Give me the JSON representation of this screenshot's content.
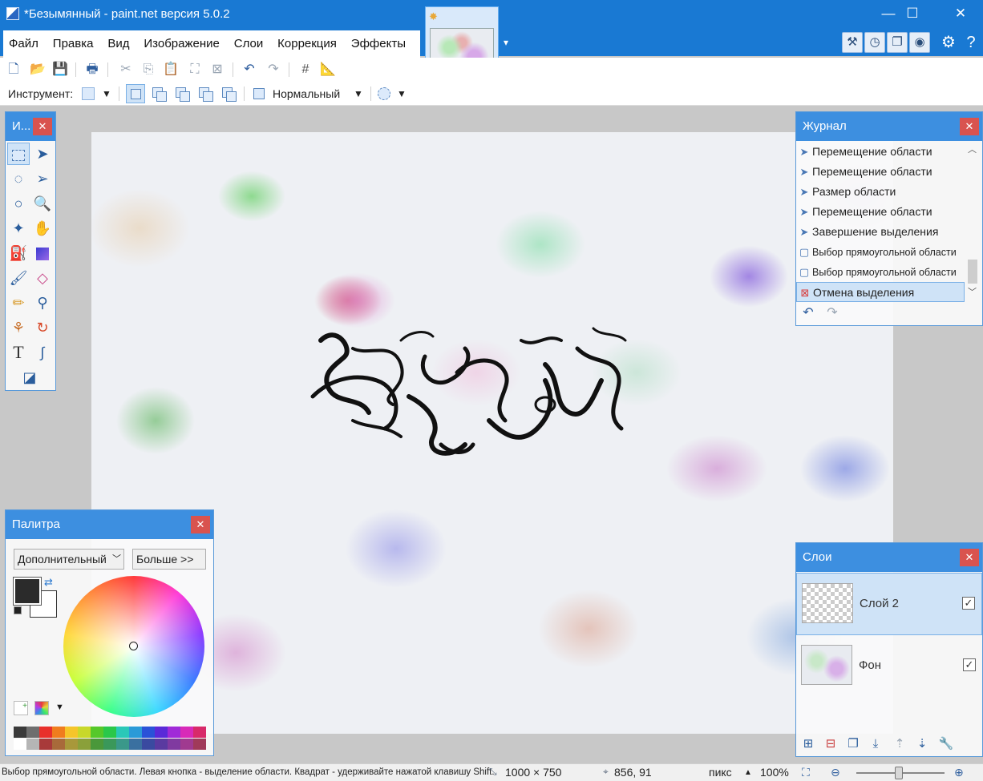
{
  "window": {
    "title": "*Безымянный - paint.net версия 5.0.2",
    "minimize": "—",
    "maximize": "☐",
    "close": "✕"
  },
  "menu": [
    "Файл",
    "Правка",
    "Вид",
    "Изображение",
    "Слои",
    "Коррекция",
    "Эффекты"
  ],
  "toolbar": {
    "tool_label": "Инструмент:",
    "blend_mode": "Нормальный"
  },
  "tools_panel": {
    "title": "И...",
    "close": "✕"
  },
  "history": {
    "title": "Журнал",
    "close": "✕",
    "items": [
      "Перемещение области",
      "Перемещение области",
      "Размер области",
      "Перемещение области",
      "Завершение выделения",
      "Выбор прямоугольной области",
      "Выбор прямоугольной области",
      "Отмена выделения"
    ],
    "selected_index": 7
  },
  "palette": {
    "title": "Палитра",
    "close": "✕",
    "mode": "Дополнительный",
    "more_button": "Больше >>",
    "primary_color": "#2b2b2b",
    "secondary_color": "#ffffff",
    "swatches_top": [
      "#3a3a3a",
      "#6e6e6e",
      "#e8302b",
      "#f07d1e",
      "#f5c52a",
      "#c8d82a",
      "#56c82a",
      "#2ac84a",
      "#2ac8b8",
      "#2a9ad8",
      "#2a52d8",
      "#5a2ad8",
      "#a02ad8",
      "#d82ab8",
      "#d82a6a"
    ],
    "swatches_bottom": [
      "#ffffff",
      "#b5b5b5",
      "#a83a3a",
      "#a86a3a",
      "#a8983a",
      "#8aa03a",
      "#4a983a",
      "#3a985a",
      "#3a988a",
      "#3a70a0",
      "#3a4aa0",
      "#5a3aa0",
      "#803aa0",
      "#a03a90",
      "#a03a5a"
    ]
  },
  "layers": {
    "title": "Слои",
    "close": "✕",
    "items": [
      {
        "name": "Слой 2",
        "visible": true,
        "selected": true
      },
      {
        "name": "Фон",
        "visible": true,
        "selected": false
      }
    ]
  },
  "status": {
    "hint": "Выбор прямоугольной области. Левая кнопка - выделение области. Квадрат - удерживайте нажатой клавишу Shift.",
    "image_size": "1000 × 750",
    "cursor_pos": "856, 91",
    "units": "пикс",
    "zoom": "100%"
  }
}
